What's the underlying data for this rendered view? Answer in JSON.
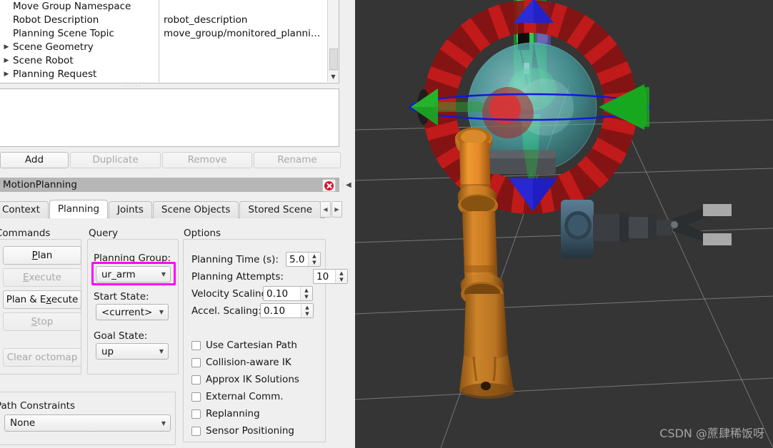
{
  "displays_tree": {
    "rows": [
      {
        "expander": false,
        "name": "Move Group Namespace",
        "value": ""
      },
      {
        "expander": false,
        "name": "Robot Description",
        "value": "robot_description"
      },
      {
        "expander": false,
        "name": "Planning Scene Topic",
        "value": "move_group/monitored_planni…"
      },
      {
        "expander": true,
        "name": "Scene Geometry",
        "value": ""
      },
      {
        "expander": true,
        "name": "Scene Robot",
        "value": ""
      },
      {
        "expander": true,
        "name": "Planning Request",
        "value": ""
      }
    ],
    "scroll_down_icon": "▼"
  },
  "display_buttons": [
    {
      "label": "Add",
      "enabled": true
    },
    {
      "label": "Duplicate",
      "enabled": false
    },
    {
      "label": "Remove",
      "enabled": false
    },
    {
      "label": "Rename",
      "enabled": false
    }
  ],
  "panel": {
    "title": "MotionPlanning",
    "close_icon": "close-icon",
    "collapse_icon": "◀"
  },
  "tabs": {
    "items": [
      {
        "label": "Context",
        "active": false,
        "clipped_left": true
      },
      {
        "label": "Planning",
        "active": true,
        "clipped_left": false
      },
      {
        "label": "Joints",
        "active": false,
        "clipped_left": false
      },
      {
        "label": "Scene Objects",
        "active": false,
        "clipped_left": false
      },
      {
        "label": "Stored Scene",
        "active": false,
        "clipped_left": false
      }
    ],
    "nav_prev": "◀",
    "nav_next": "▶"
  },
  "planning": {
    "commands": {
      "title": "Commands",
      "buttons": [
        {
          "label": "Plan",
          "mnemonic": "P",
          "enabled": true
        },
        {
          "label": "Execute",
          "mnemonic": "E",
          "enabled": false
        },
        {
          "label": "Plan & Execute",
          "mnemonic": "x",
          "enabled": true
        },
        {
          "label": "Stop",
          "mnemonic": "S",
          "enabled": false
        },
        {
          "label": "Clear octomap",
          "mnemonic": "",
          "enabled": false
        }
      ]
    },
    "query": {
      "title": "Query",
      "planning_group_label": "Planning Group:",
      "planning_group_value": "ur_arm",
      "start_state_label": "Start State:",
      "start_state_value": "<current>",
      "goal_state_label": "Goal State:",
      "goal_state_value": "up",
      "highlight_color": "#ff00ff"
    },
    "options": {
      "title": "Options",
      "fields": [
        {
          "label": "Planning Time (s):",
          "value": "5.0"
        },
        {
          "label": "Planning Attempts:",
          "value": "10"
        },
        {
          "label": "Velocity Scaling:",
          "value": "0.10"
        },
        {
          "label": "Accel. Scaling:",
          "value": "0.10"
        }
      ],
      "checkboxes": [
        {
          "label": "Use Cartesian Path",
          "checked": false
        },
        {
          "label": "Collision-aware IK",
          "checked": false
        },
        {
          "label": "Approx IK Solutions",
          "checked": false
        },
        {
          "label": "External Comm.",
          "checked": false
        },
        {
          "label": "Replanning",
          "checked": false
        },
        {
          "label": "Sensor Positioning",
          "checked": false
        }
      ]
    },
    "path_constraints": {
      "title": "Path Constraints",
      "value": "None"
    }
  },
  "viewport": {
    "background_color": "#353535",
    "grid_color": "#9a9a9a",
    "robot_color": "#e08c28",
    "ghost_robot_color": "#00d23a",
    "marker": {
      "ring_color": "#b01212",
      "x_arrow_color": "#11a31a",
      "z_arrow_color": "#1a1ad0",
      "sphere_color": "#49c2c4",
      "ring_circle_color": "#1414d2"
    },
    "watermark": "CSDN @蔗肆稀饭呀"
  }
}
